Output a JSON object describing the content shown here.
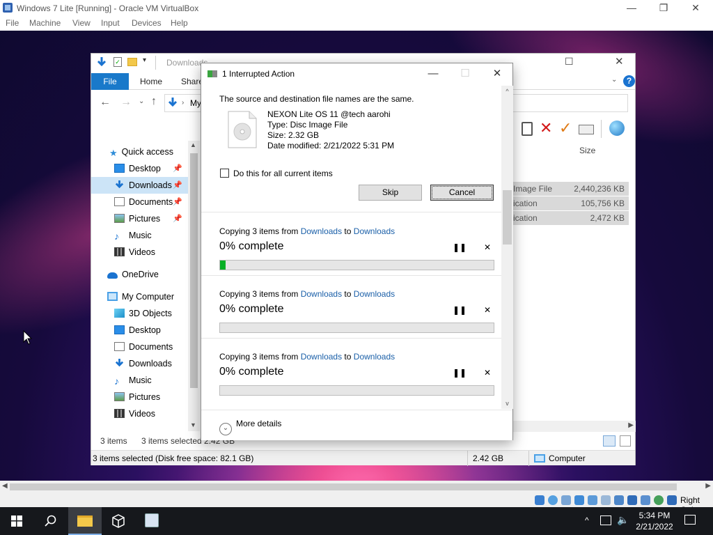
{
  "vbox": {
    "title": "Windows 7 Lite [Running] - Oracle VM VirtualBox",
    "menu": [
      "File",
      "Machine",
      "View",
      "Input",
      "Devices",
      "Help"
    ],
    "host_key": "Right Ctrl"
  },
  "explorer": {
    "qat_title": "Downloads",
    "tabs": {
      "file": "File",
      "home": "Home",
      "share": "Share"
    },
    "address_partial": "My",
    "column_size": "Size",
    "rows": [
      {
        "type": "Image File",
        "size": "2,440,236 KB"
      },
      {
        "type": "ication",
        "size": "105,756 KB"
      },
      {
        "type": "ication",
        "size": "2,472 KB"
      }
    ],
    "nav": [
      {
        "label": "Quick access",
        "icon": "star-icon"
      },
      {
        "label": "Desktop",
        "icon": "desktop-icon"
      },
      {
        "label": "Downloads",
        "icon": "download-arrow-icon"
      },
      {
        "label": "Documents",
        "icon": "documents-icon"
      },
      {
        "label": "Pictures",
        "icon": "pictures-icon"
      },
      {
        "label": "Music",
        "icon": "music-note-icon"
      },
      {
        "label": "Videos",
        "icon": "film-icon"
      },
      {
        "label": "OneDrive",
        "icon": "cloud-icon"
      },
      {
        "label": "My Computer",
        "icon": "computer-icon"
      },
      {
        "label": "3D Objects",
        "icon": "cube-icon"
      },
      {
        "label": "Desktop",
        "icon": "desktop-icon"
      },
      {
        "label": "Documents",
        "icon": "documents-icon"
      },
      {
        "label": "Downloads",
        "icon": "download-arrow-icon"
      },
      {
        "label": "Music",
        "icon": "music-note-icon"
      },
      {
        "label": "Pictures",
        "icon": "pictures-icon"
      },
      {
        "label": "Videos",
        "icon": "film-icon"
      }
    ],
    "status_items": "3 items",
    "status_selected": "3 items selected  2.42 GB",
    "status2_left": "3 items selected (Disk free space: 82.1 GB)",
    "status2_size": "2.42 GB",
    "status2_location": "Computer"
  },
  "dialog": {
    "title": "1 Interrupted Action",
    "message": "The source and destination file names are the same.",
    "file": {
      "name": "NEXON Lite OS 11 @tech aarohi",
      "type": "Type: Disc Image File",
      "size": "Size: 2.32 GB",
      "modified": "Date modified: 2/21/2022 5:31 PM"
    },
    "checkbox_label": "Do this for all current items",
    "skip_label": "Skip",
    "cancel_label": "Cancel",
    "copies": [
      {
        "prefix": "Copying 3 items from ",
        "from": "Downloads",
        "mid": " to ",
        "to": "Downloads",
        "percent_text": "0% complete",
        "progress": 0.02
      },
      {
        "prefix": "Copying 3 items from ",
        "from": "Downloads",
        "mid": " to ",
        "to": "Downloads",
        "percent_text": "0% complete",
        "progress": 0
      },
      {
        "prefix": "Copying 3 items from ",
        "from": "Downloads",
        "mid": " to ",
        "to": "Downloads",
        "percent_text": "0% complete",
        "progress": 0
      }
    ],
    "more_details": "More details"
  },
  "taskbar": {
    "time": "5:34 PM",
    "date": "2/21/2022"
  }
}
